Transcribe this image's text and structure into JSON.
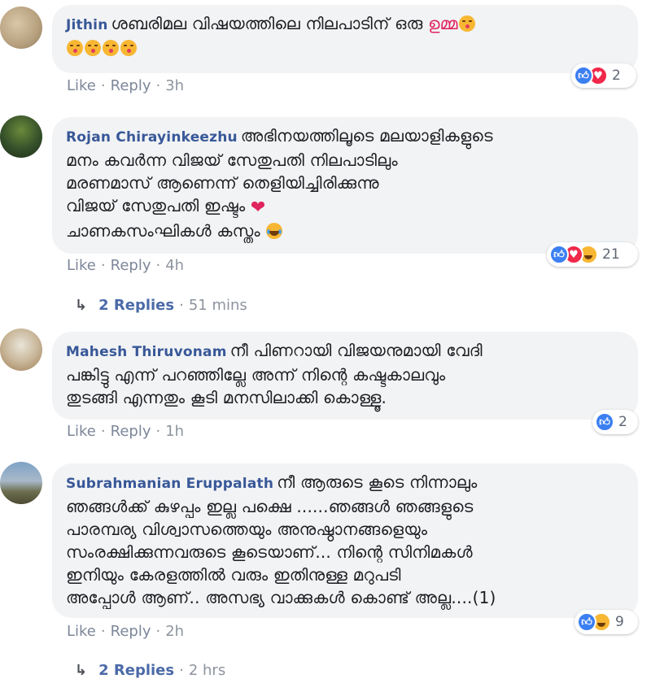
{
  "comments": [
    {
      "author": "Jithin",
      "line1": "ശബരിമല വിഷയത്തിലെ നിലപാടിന് ഒരു ",
      "highlight": "ഉമ്മ",
      "lines": "",
      "actions": {
        "like": "Like",
        "reply": "Reply",
        "time": "3h"
      },
      "reactions": {
        "types": [
          "like",
          "love"
        ],
        "count": "2"
      }
    },
    {
      "author": "Rojan Chirayinkeezhu",
      "line1": "അഭിനയത്തിലൂടെ മലയാളികളുടെ",
      "lines": "മനം കവർന്ന വിജയ് സേതുപതി നിലപാടിലും\nമരണമാസ് ആണെന്ന് തെളിയിച്ചിരിക്കുന്നു",
      "line_love": "വിജയ് സേതുപതി ഇഷ്ടം",
      "line_last": "ചാണകസംഘികൾ കസ്തം",
      "actions": {
        "like": "Like",
        "reply": "Reply",
        "time": "4h"
      },
      "reactions": {
        "types": [
          "like",
          "love",
          "haha"
        ],
        "count": "21"
      },
      "replies": {
        "label": "2 Replies",
        "time": "51 mins"
      }
    },
    {
      "author": "Mahesh Thiruvonam",
      "line1": "നീ പിണറായി വിജയനുമായി വേദി",
      "lines": "പങ്കിട്ടു എന്ന് പറഞ്ഞില്ലേ അന്ന് നിന്റെ കഷ്ടകാലവും\nതുടങ്ങി എന്നതും കൂടി മനസിലാക്കി കൊള്ളൂ.",
      "actions": {
        "like": "Like",
        "reply": "Reply",
        "time": "1h"
      },
      "reactions": {
        "types": [
          "like"
        ],
        "count": "2"
      }
    },
    {
      "author": "Subrahmanian Eruppalath",
      "line1": "നീ ആരുടെ കൂടെ നിന്നാലും",
      "lines": "ഞങ്ങൾക്ക് കുഴപ്പം ഇല്ല പക്ഷെ ......ഞങ്ങൾ ഞങ്ങളുടെ\nപാരമ്പര്യ വിശ്വാസത്തെയും അനുഷ്ഠാനങ്ങളെയും\nസംരക്ഷിക്കുന്നവരുടെ കൂടെയാണ്... നിന്റെ സിനിമകൾ\nഇനിയും കേരളത്തിൽ വരും ഇതിനുള്ള മറുപടി\nഅപ്പോൾ ആണ്.. അസഭ്യ വാക്കുകൾ കൊണ്ട് അല്ല....(1)",
      "actions": {
        "like": "Like",
        "reply": "Reply",
        "time": "2h"
      },
      "reactions": {
        "types": [
          "like",
          "haha"
        ],
        "count": "9"
      },
      "replies": {
        "label": "2 Replies",
        "time": "2 hrs"
      }
    }
  ],
  "separator": "·",
  "reply_arrow": "↳",
  "colors": {
    "author": "#385898",
    "bubble": "#f2f3f5",
    "meta": "#8d949e",
    "like": "#3b7ff2",
    "love": "#f0284a",
    "haha": "#f7b733"
  }
}
